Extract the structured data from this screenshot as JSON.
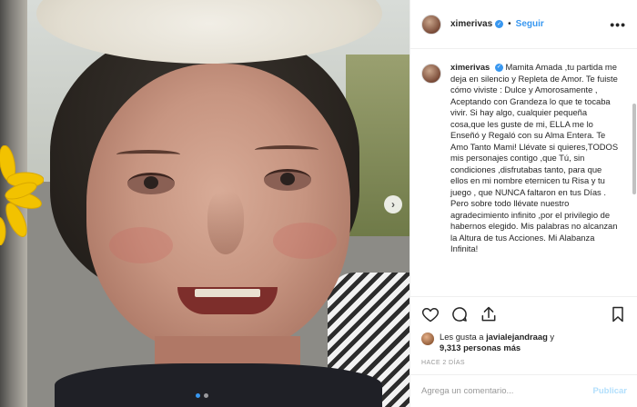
{
  "post": {
    "username": "ximerivas",
    "separator": "•",
    "follow_label": "Seguir",
    "more_label": "•••",
    "caption": "Mamita Amada ,tu partida me deja en silencio y Repleta de Amor. Te fuiste cómo viviste : Dulce y Amorosamente , Aceptando con Grandeza lo que te tocaba vivir. Si hay algo, cualquier pequeña cosa,que les guste de mi, ELLA me lo Enseñó y Regaló con su Alma Entera. Te Amo Tanto Mami! Llévate si quieres,TODOS mis personajes contigo ,que Tú, sin condiciones ,disfrutabas tanto, para que ellos en mi nombre eternicen tu Risa y tu juego , que NUNCA faltaron en tus Días .\nPero sobre todo llévate nuestro agradecimiento infinito ,por el privilegio de habernos elegido. Mis palabras no alcanzan la Altura de tus Acciones. Mi Alabanza Infinita!",
    "likes": {
      "prefix": "Les gusta a ",
      "user": "javialejandraag",
      "middle": " y",
      "count_text": "9,313 personas más"
    },
    "timestamp": "HACE 2 DÍAS",
    "comment_placeholder": "Agrega un comentario...",
    "publish_label": "Publicar"
  },
  "carousel": {
    "next_glyph": "›",
    "slide_count": 2,
    "active_slide": 1
  },
  "icons": {
    "like": "heart-icon",
    "comment": "comment-icon",
    "share": "share-icon",
    "save": "bookmark-icon",
    "verified": "verified-badge-icon"
  },
  "colors": {
    "accent": "#3897f0",
    "publish_disabled": "#b2dffc",
    "text": "#262626",
    "muted": "#999999",
    "border": "#efefef"
  }
}
